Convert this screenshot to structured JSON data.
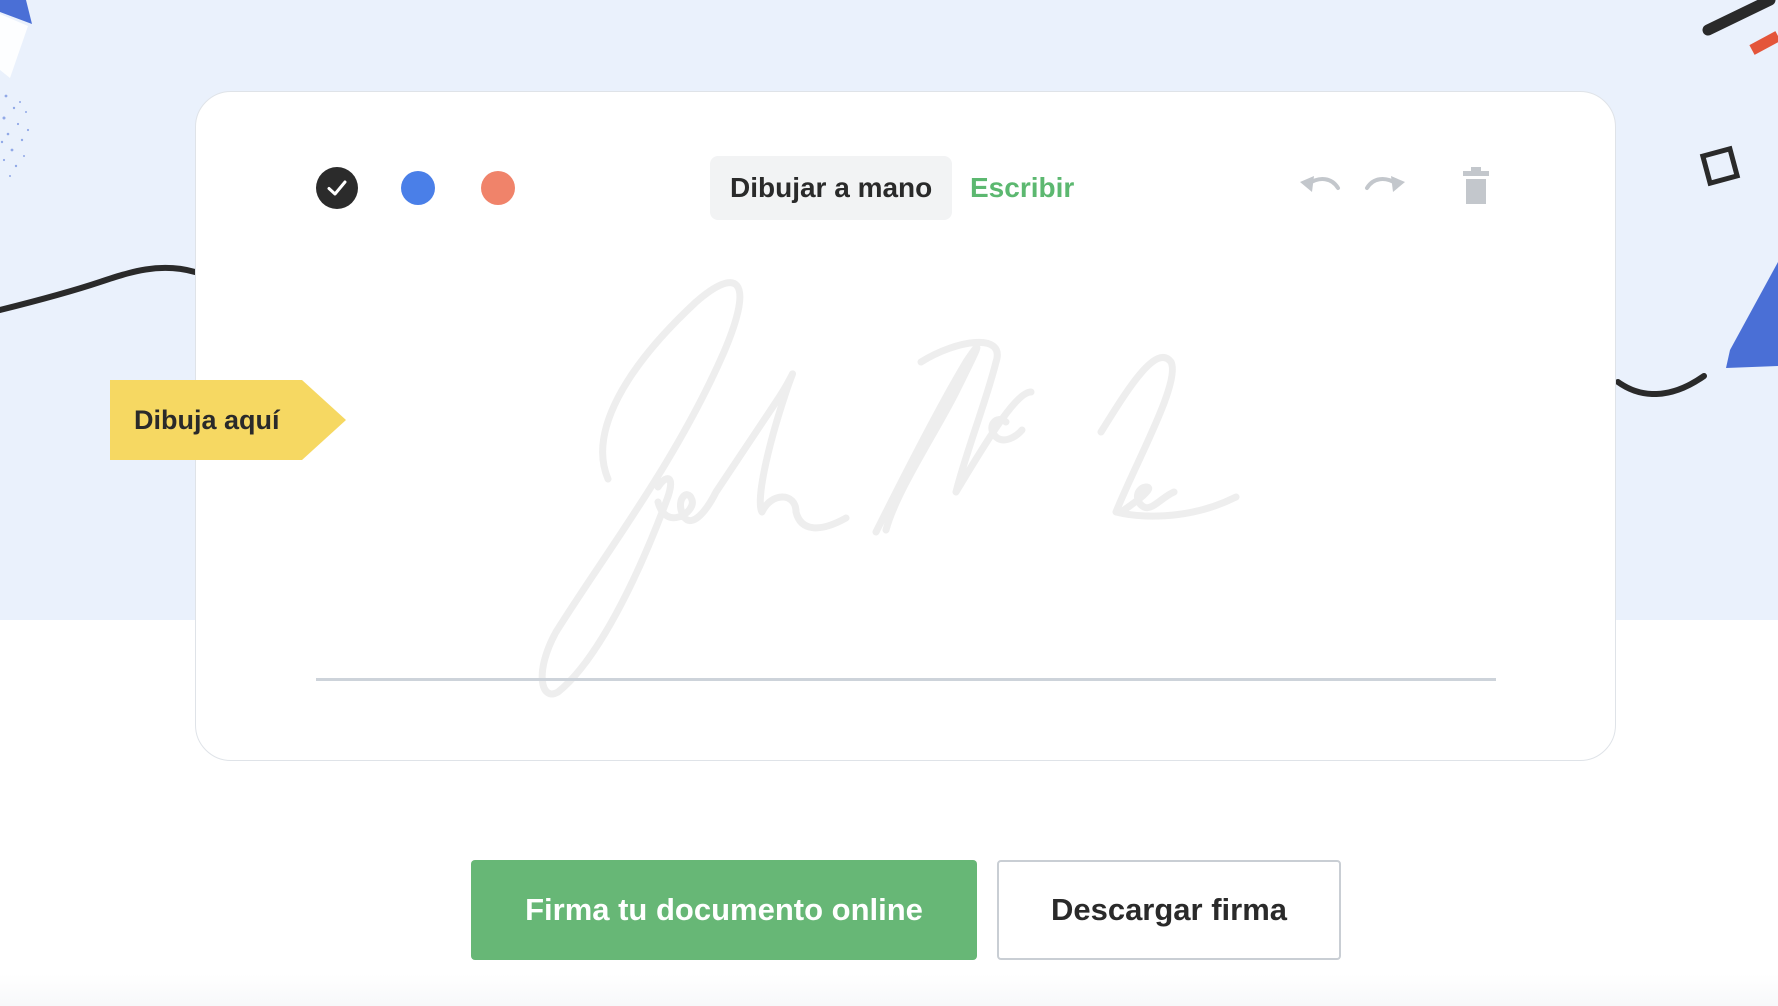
{
  "toolbar": {
    "colors": [
      {
        "name": "black",
        "hex": "#2b2b2b",
        "selected": true
      },
      {
        "name": "blue",
        "hex": "#4a7fe8",
        "selected": false
      },
      {
        "name": "orange",
        "hex": "#f0836a",
        "selected": false
      }
    ],
    "tabs": [
      {
        "label": "Dibujar a mano",
        "active": true
      },
      {
        "label": "Escribir",
        "active": false
      }
    ],
    "icons": [
      "undo-icon",
      "redo-icon",
      "trash-icon"
    ]
  },
  "canvas": {
    "hint_label": "Dibuja aquí",
    "placeholder_signature": "John McLain (handwritten sample)"
  },
  "actions": {
    "primary_label": "Firma tu documento online",
    "secondary_label": "Descargar firma"
  },
  "colors": {
    "accent_green": "#67b776",
    "hint_yellow": "#f6d862",
    "band_blue": "#eaf1fc"
  }
}
